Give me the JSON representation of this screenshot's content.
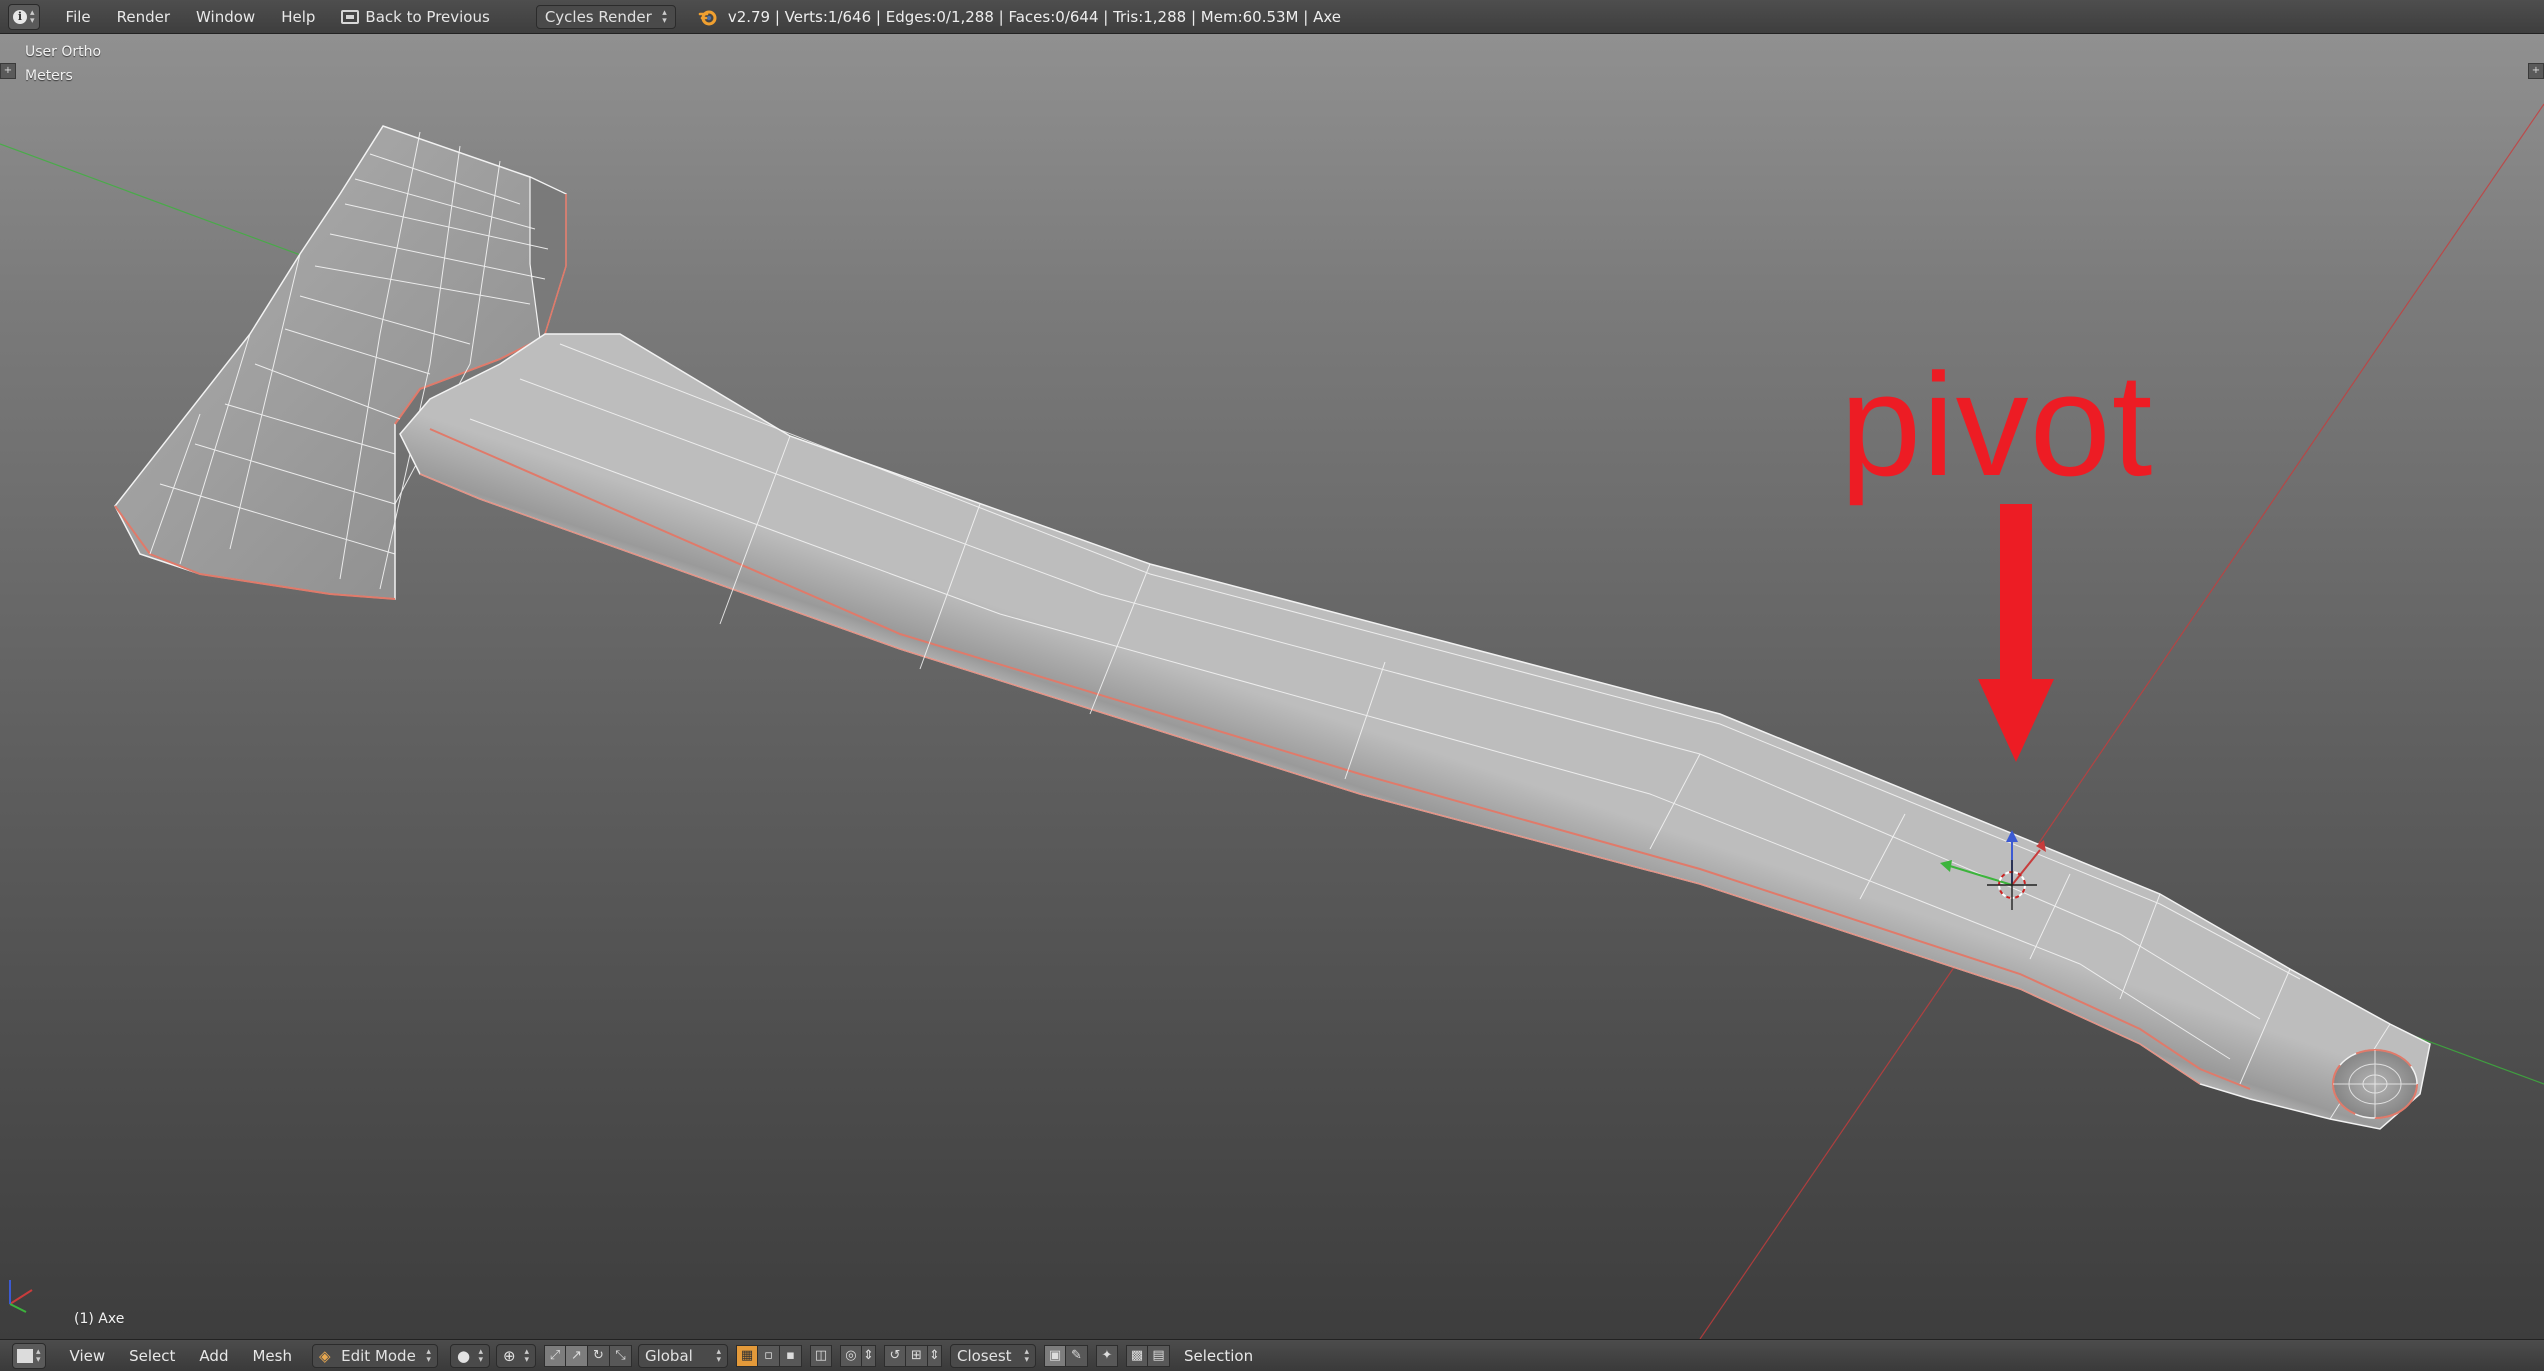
{
  "header": {
    "menu": [
      "File",
      "Render",
      "Window",
      "Help"
    ],
    "back_button": "Back to Previous",
    "render_engine": "Cycles Render",
    "stats": "v2.79 | Verts:1/646 | Edges:0/1,288 | Faces:0/644 | Tris:1,288 | Mem:60.53M | Axe"
  },
  "viewport": {
    "view_name": "User Ortho",
    "units": "Meters",
    "object_name": "(1) Axe",
    "annotation": "pivot",
    "annotation_color": "#ed1c24",
    "selected_edge_color": "#e07a6a",
    "axis_colors": {
      "x": "#c83c3c",
      "y": "#3cb43c",
      "z": "#3c5ad2"
    }
  },
  "footer": {
    "menu": [
      "View",
      "Select",
      "Add",
      "Mesh"
    ],
    "mode": "Edit Mode",
    "orientation": "Global",
    "snap_target": "Closest",
    "selection_label": "Selection"
  }
}
